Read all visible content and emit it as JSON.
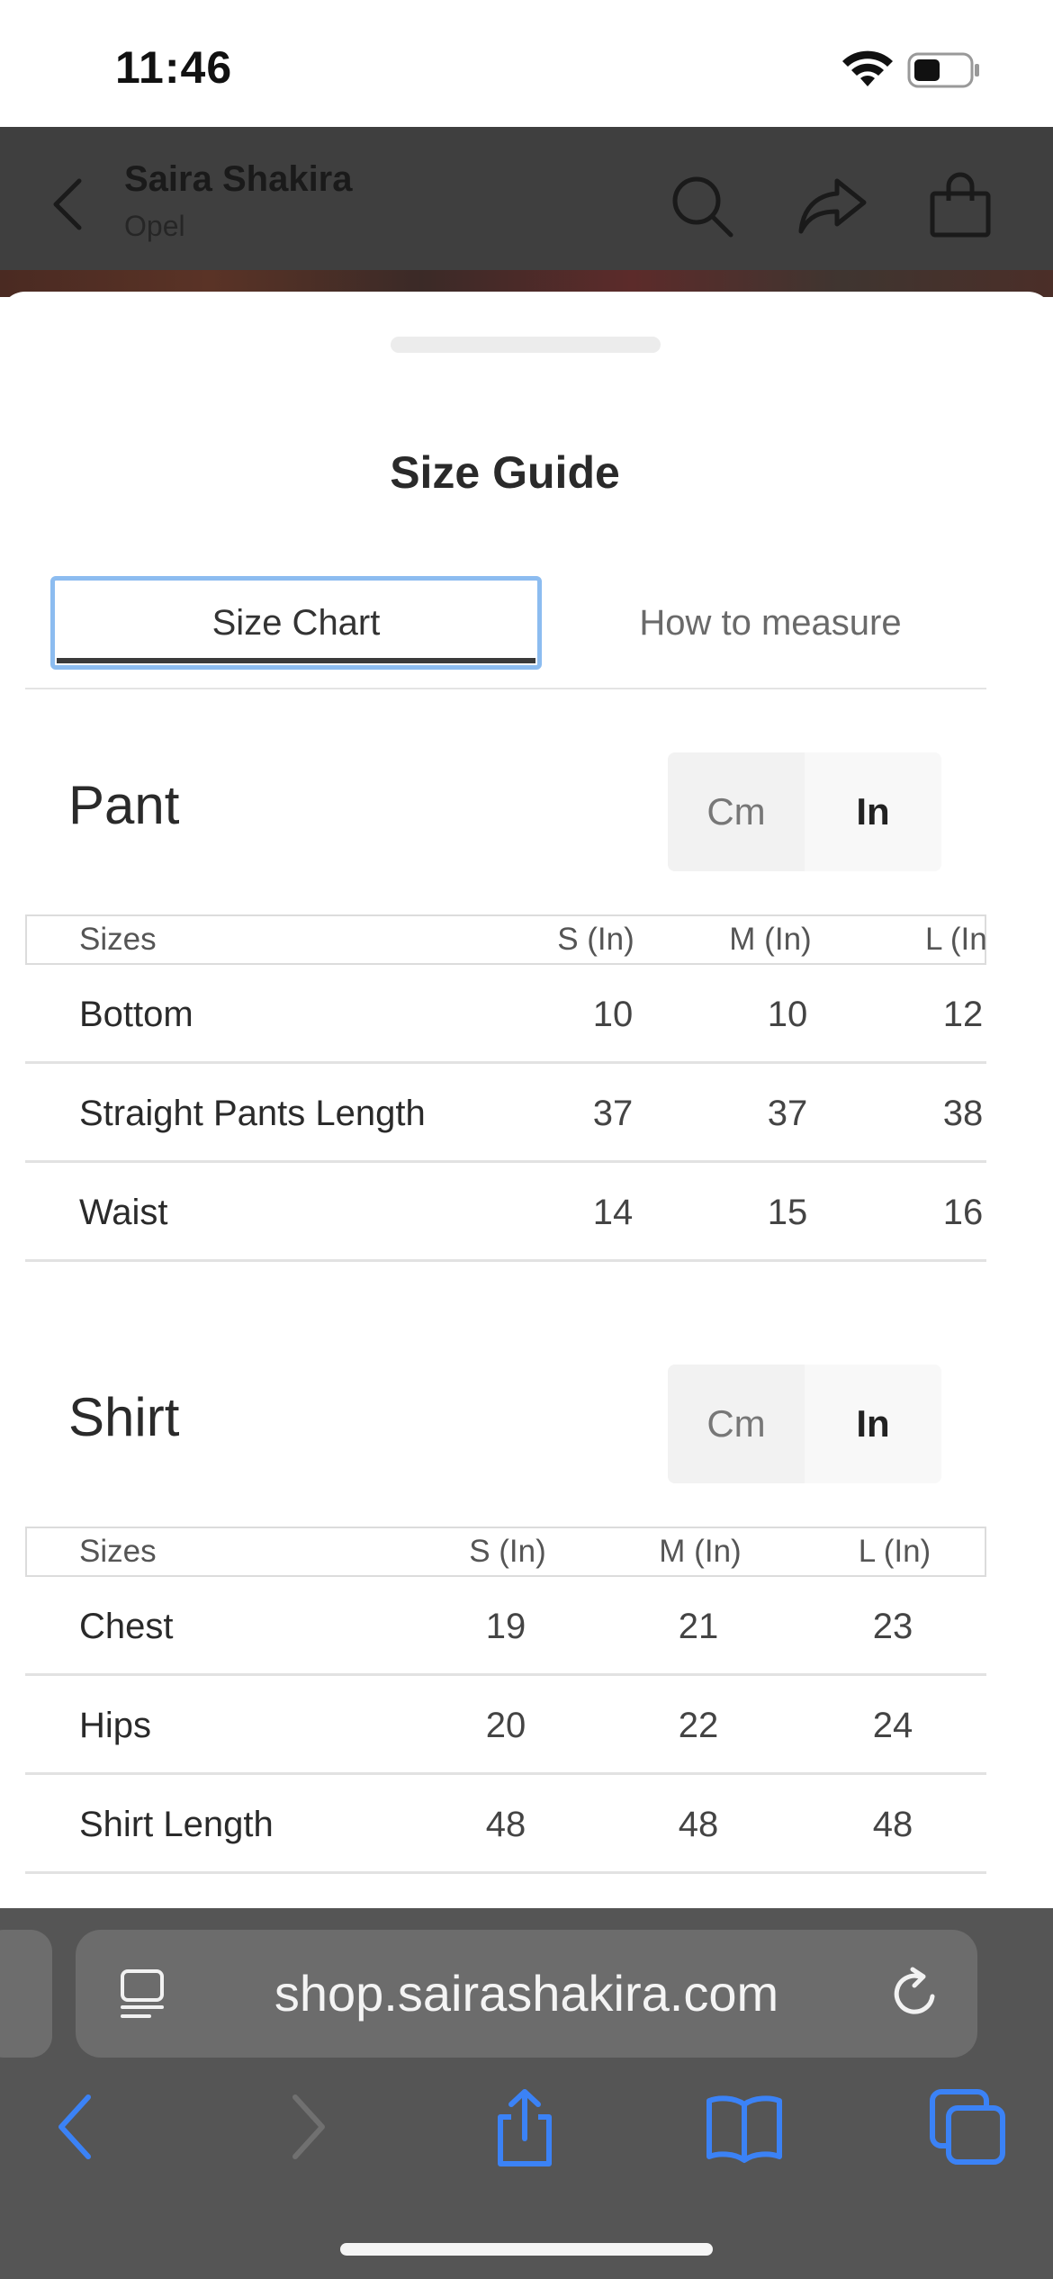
{
  "status_bar": {
    "time": "11:46"
  },
  "app_header": {
    "title": "Saira Shakira",
    "subtitle": "Opel"
  },
  "size_guide": {
    "title": "Size Guide",
    "tabs": [
      {
        "label": "Size Chart",
        "active": true
      },
      {
        "label": "How to measure",
        "active": false
      }
    ],
    "unit_options": [
      "Cm",
      "In"
    ],
    "selected_unit": "In",
    "pant": {
      "title": "Pant",
      "headers": [
        "Sizes",
        "S (In)",
        "M (In)",
        "L (In)"
      ],
      "rows": [
        {
          "label": "Bottom",
          "values": [
            "10",
            "10",
            "12"
          ]
        },
        {
          "label": "Straight Pants Length",
          "values": [
            "37",
            "37",
            "38"
          ]
        },
        {
          "label": "Waist",
          "values": [
            "14",
            "15",
            "16"
          ]
        }
      ]
    },
    "shirt": {
      "title": "Shirt",
      "headers": [
        "Sizes",
        "S (In)",
        "M (In)",
        "L (In)"
      ],
      "rows": [
        {
          "label": "Chest",
          "values": [
            "19",
            "21",
            "23"
          ]
        },
        {
          "label": "Hips",
          "values": [
            "20",
            "22",
            "24"
          ]
        },
        {
          "label": "Shirt Length",
          "values": [
            "48",
            "48",
            "48"
          ]
        }
      ]
    }
  },
  "browser": {
    "url": "shop.sairashakira.com"
  },
  "colors": {
    "accent_blue": "#3b82f6",
    "tab_focus": "#8cbcf0",
    "toolbar_bg": "#555555"
  }
}
